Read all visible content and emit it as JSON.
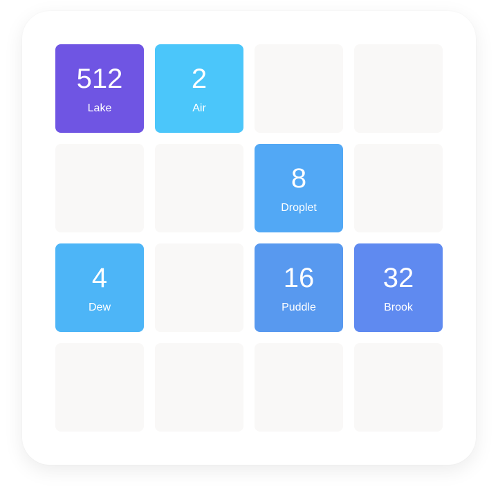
{
  "cells": [
    {
      "value": "512",
      "label": "Lake",
      "color": "#6F55E3"
    },
    {
      "value": "2",
      "label": "Air",
      "color": "#4BC6FA"
    },
    {
      "value": "",
      "label": "",
      "color": ""
    },
    {
      "value": "",
      "label": "",
      "color": ""
    },
    {
      "value": "",
      "label": "",
      "color": ""
    },
    {
      "value": "",
      "label": "",
      "color": ""
    },
    {
      "value": "8",
      "label": "Droplet",
      "color": "#52A8F5"
    },
    {
      "value": "",
      "label": "",
      "color": ""
    },
    {
      "value": "4",
      "label": "Dew",
      "color": "#4DB5F7"
    },
    {
      "value": "",
      "label": "",
      "color": ""
    },
    {
      "value": "16",
      "label": "Puddle",
      "color": "#5899EF"
    },
    {
      "value": "32",
      "label": "Brook",
      "color": "#5F8AF0"
    },
    {
      "value": "",
      "label": "",
      "color": ""
    },
    {
      "value": "",
      "label": "",
      "color": ""
    },
    {
      "value": "",
      "label": "",
      "color": ""
    },
    {
      "value": "",
      "label": "",
      "color": ""
    }
  ],
  "empty_color": "#F9F8F7"
}
